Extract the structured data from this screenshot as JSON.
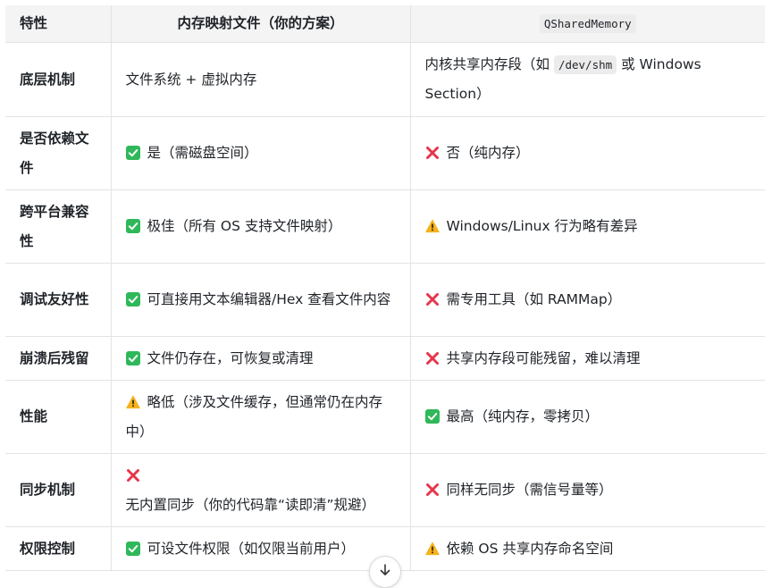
{
  "header": {
    "col1": "特性",
    "col2": "内存映射文件（你的方案）",
    "col3_code": "QSharedMemory"
  },
  "rows": [
    {
      "feature": "底层机制",
      "mmf": {
        "icon": "",
        "text": "文件系统 + 虚拟内存"
      },
      "qsm": {
        "icon": "",
        "before": "内核共享内存段（如 ",
        "code": "/dev/shm",
        "after": " 或 Windows Section）"
      }
    },
    {
      "feature": "是否依赖文件",
      "mmf": {
        "icon": "check-icon",
        "text": "是（需磁盘空间）"
      },
      "qsm": {
        "icon": "cross-icon",
        "text": "否（纯内存）"
      }
    },
    {
      "feature": "跨平台兼容性",
      "mmf": {
        "icon": "check-icon",
        "text": "极佳（所有 OS 支持文件映射）"
      },
      "qsm": {
        "icon": "warning-icon",
        "text": "Windows/Linux 行为略有差异"
      }
    },
    {
      "feature": "调试友好性",
      "mmf": {
        "icon": "check-icon",
        "text": "可直接用文本编辑器/Hex 查看文件内容"
      },
      "qsm": {
        "icon": "cross-icon",
        "text": "需专用工具（如 RAMMap）"
      }
    },
    {
      "feature": "崩溃后残留",
      "mmf": {
        "icon": "check-icon",
        "text": "文件仍存在，可恢复或清理"
      },
      "qsm": {
        "icon": "cross-icon",
        "text": "共享内存段可能残留，难以清理"
      }
    },
    {
      "feature": "性能",
      "mmf": {
        "icon": "warning-icon",
        "text": "略低（涉及文件缓存，但通常仍在内存中）"
      },
      "qsm": {
        "icon": "check-icon",
        "text": "最高（纯内存，零拷贝）"
      }
    },
    {
      "feature": "同步机制",
      "mmf": {
        "icon": "cross-icon",
        "text": "无内置同步（你的代码靠“读即清”规避）"
      },
      "qsm": {
        "icon": "cross-icon",
        "text": "同样无同步（需信号量等）"
      }
    },
    {
      "feature": "权限控制",
      "mmf": {
        "icon": "check-icon",
        "text": "可设文件权限（如仅限当前用户）"
      },
      "qsm": {
        "icon": "warning-icon",
        "text": "依赖 OS 共享内存命名空间"
      }
    }
  ],
  "scroll_button": {
    "icon": "arrow-down-icon"
  },
  "colors": {
    "check": "#2fb85a",
    "cross": "#e5364b",
    "warning": "#f5b21b"
  }
}
